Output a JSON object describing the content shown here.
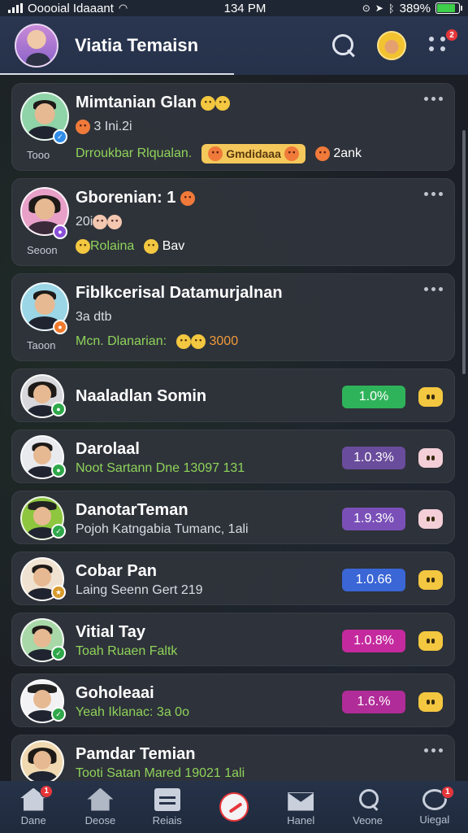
{
  "status_bar": {
    "carrier": "Ooooial Idaaant",
    "time": "134 PM",
    "battery": "389%"
  },
  "header": {
    "title": "Viatia Temaisn",
    "menu_badge": "2"
  },
  "cards_big": [
    {
      "name": "Mimtanian Glan",
      "sub": "3 Ini.2i",
      "time": "Tooo",
      "tag_green": "Drroukbar Rlqualan.",
      "chip": "Gmdidaaa",
      "tag_extra": "2ank",
      "status_icon": "verified-icon",
      "status_color": "#2f8ce8"
    },
    {
      "name": "Gborenian: 1",
      "sub": "20i",
      "time": "Seoon",
      "tag_green": "Rolaina",
      "chip": "",
      "tag_extra": "Bav",
      "status_icon": "camera-icon",
      "status_color": "#8a4fd6"
    },
    {
      "name": "Fiblkcerisal Datamurjalnan",
      "sub": "3a dtb",
      "time": "Taoon",
      "tag_green": "Mcn. Dlanarian:",
      "chip": "",
      "tag_extra": "3000",
      "status_icon": "flame-icon",
      "status_color": "#f07a2a"
    }
  ],
  "cards_small": [
    {
      "name": "Naaladlan Somin",
      "sub": "",
      "sub_green": false,
      "pill": "1.0%",
      "pill_color": "#2fb35a",
      "react_color": "#f3c740",
      "status_icon": "chat-icon"
    },
    {
      "name": "Darolaal",
      "sub": "Noot Sartann Dne 13097 131",
      "sub_green": false,
      "pill": "1.0.3%",
      "pill_color": "#6a4c9c",
      "react_color": "#f4cfd8",
      "status_icon": "phone-icon"
    },
    {
      "name": "DanotarTeman",
      "sub": "Pojoh Katngabia Tumanc, 1ali",
      "sub_green": false,
      "pill": "1.9.3%",
      "pill_color": "#7a50b8",
      "react_color": "#f4cfd8",
      "status_icon": "check-icon"
    },
    {
      "name": "Cobar Pan",
      "sub": "Laing Seenn Gert 219",
      "sub_green": false,
      "pill": "1.0.66",
      "pill_color": "#3a66d6",
      "react_color": "#f3c740",
      "status_icon": "star-icon"
    },
    {
      "name": "Vitial Tay",
      "sub": "Toah Ruaen Faltk",
      "sub_green": true,
      "pill": "1.0.8%",
      "pill_color": "#c42a9e",
      "react_color": "#f3c740",
      "status_icon": "check-icon"
    },
    {
      "name": "Goholeaai",
      "sub": "Yeah Iklanac: 3a 0o",
      "sub_green": true,
      "pill": "1.6.%",
      "pill_color": "#b02c98",
      "react_color": "#f3c740",
      "status_icon": "check-icon"
    },
    {
      "name": "Pamdar Temian",
      "sub": "Tooti Satan Mared 19021 1ali",
      "sub_green": true,
      "pill": "",
      "pill_color": "",
      "react_color": "",
      "status_icon": ""
    }
  ],
  "bottom_nav": [
    {
      "label": "Dane",
      "icon": "home-icon",
      "badge": "1"
    },
    {
      "label": "Deose",
      "icon": "house-icon",
      "badge": ""
    },
    {
      "label": "Reiais",
      "icon": "archive-icon",
      "badge": ""
    },
    {
      "label": "",
      "icon": "create-icon",
      "badge": ""
    },
    {
      "label": "Hanel",
      "icon": "mail-icon",
      "badge": ""
    },
    {
      "label": "Veone",
      "icon": "search-icon",
      "badge": ""
    },
    {
      "label": "Uiegal",
      "icon": "chat-icon",
      "badge": "1"
    }
  ]
}
